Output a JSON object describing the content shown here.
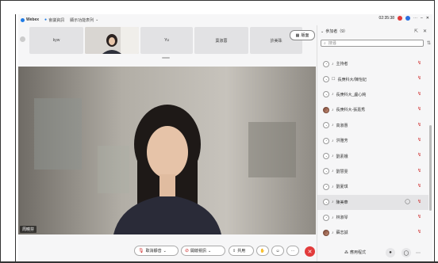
{
  "titlebar": {
    "brand": "Webex",
    "meeting_info": "會議資訊",
    "menu": "顯示功能表列",
    "time": "02:35:38"
  },
  "strip_tiles": [
    {
      "name": "kyw"
    },
    {
      "name": ""
    },
    {
      "name": "Yu"
    },
    {
      "name": "葉淑蓉"
    },
    {
      "name": "許美珠"
    }
  ],
  "layout_button": "版面",
  "video": {
    "speaker_name": "周曉芬"
  },
  "controls": {
    "unmute": "取消靜音",
    "start_video": "開啟視訊",
    "share": "共用",
    "end_icon": "close-icon"
  },
  "panel": {
    "title": "參加者（9）",
    "search_placeholder": "搜尋",
    "participants": [
      {
        "name": "主持者",
        "mic": "mic-icon"
      },
      {
        "name": "長庚科大/陳怡妃",
        "mic": "phone-icon"
      },
      {
        "name": "長庚科大_盧心純",
        "mic": "mic-icon"
      },
      {
        "name": "長庚科大-張嘉秀",
        "mic": "mic-icon",
        "photo": true
      },
      {
        "name": "高淑惠",
        "mic": "mic-icon"
      },
      {
        "name": "洪雅芳",
        "mic": "mic-icon"
      },
      {
        "name": "劉素娥",
        "mic": "mic-icon"
      },
      {
        "name": "劉慧雯",
        "mic": "mic-icon"
      },
      {
        "name": "劉夏琪",
        "mic": "mic-icon"
      },
      {
        "name": "陳美華",
        "mic": "mic-icon",
        "selected": true
      },
      {
        "name": "林淑琴",
        "mic": "mic-icon"
      },
      {
        "name": "蘇志誠",
        "mic": "mic-icon",
        "photo": true
      }
    ],
    "apps_label": "應用程式"
  }
}
